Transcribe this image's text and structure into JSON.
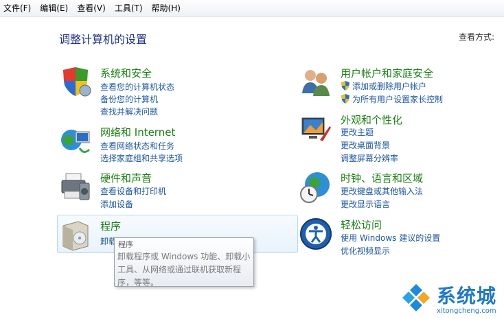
{
  "menubar": {
    "file": "文件(F)",
    "edit": "编辑(E)",
    "view": "查看(V)",
    "tools": "工具(T)",
    "help": "帮助(H)"
  },
  "page": {
    "title": "调整计算机的设置",
    "view_by": "查看方式:"
  },
  "categories": {
    "system_security": {
      "title": "系统和安全",
      "links": [
        "查看您的计算机状态",
        "备份您的计算机",
        "查找并解决问题"
      ]
    },
    "network": {
      "title": "网络和 Internet",
      "links": [
        "查看网络状态和任务",
        "选择家庭组和共享选项"
      ]
    },
    "hardware": {
      "title": "硬件和声音",
      "links": [
        "查看设备和打印机",
        "添加设备"
      ]
    },
    "programs": {
      "title": "程序",
      "links": [
        "卸载程序"
      ]
    },
    "user_accounts": {
      "title": "用户帐户和家庭安全",
      "links": [
        "添加或删除用户帐户",
        "为所有用户设置家长控制"
      ]
    },
    "appearance": {
      "title": "外观和个性化",
      "links": [
        "更改主题",
        "更改桌面背景",
        "调整屏幕分辨率"
      ]
    },
    "clock": {
      "title": "时钟、语言和区域",
      "links": [
        "更改键盘或其他输入法",
        "更改显示语言"
      ]
    },
    "ease": {
      "title": "轻松访问",
      "links": [
        "使用 Windows 建议的设置",
        "优化视频显示"
      ]
    }
  },
  "tooltip": {
    "title": "程序",
    "line1": "卸载程序或 Windows 功能、卸载小",
    "line2": "工具、从网络或通过联机获取新程",
    "line3": "序，等等。"
  },
  "watermark": {
    "text": "系统城",
    "url": "xitongcheng.com"
  },
  "colors": {
    "heading_green": "#1b7e15",
    "link_blue": "#1e57a4",
    "title_blue": "#1e3287",
    "watermark_blue": "#1f78c8"
  }
}
